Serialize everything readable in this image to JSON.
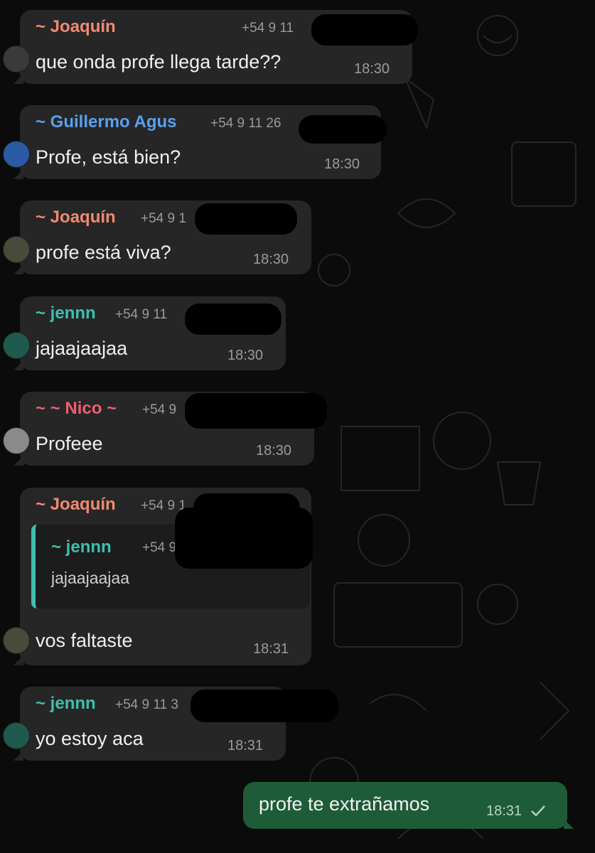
{
  "messages": [
    {
      "sender": "~ Joaquín",
      "sender_color": "#f08a72",
      "phone": "+54 9 11",
      "text": "que onda profe llega tarde??",
      "time": "18:30"
    },
    {
      "sender": "~ Guillermo Agus",
      "sender_color": "#5aa0ee",
      "phone": "+54 9 11 26",
      "text": "Profe, está bien?",
      "time": "18:30"
    },
    {
      "sender": "~ Joaquín",
      "sender_color": "#f08a72",
      "phone": "+54 9 1",
      "text": "profe está viva?",
      "time": "18:30"
    },
    {
      "sender": "~ jennn",
      "sender_color": "#3fbfae",
      "phone": "+54 9 11",
      "text": "jajaajaajaa",
      "time": "18:30"
    },
    {
      "sender": "~ ~ Nico ~",
      "sender_color": "#ee5f73",
      "phone": "+54 9",
      "text": "Profeee",
      "time": "18:30"
    },
    {
      "sender": "~ Joaquín",
      "sender_color": "#f08a72",
      "phone": "+54 9 1",
      "quote": {
        "sender": "~ jennn",
        "phone": "+54 9",
        "text": "jajaajaajaa"
      },
      "text": "vos faltaste",
      "time": "18:31"
    },
    {
      "sender": "~ jennn",
      "sender_color": "#3fbfae",
      "phone": "+54 9 11 3",
      "text": "yo estoy aca",
      "time": "18:31"
    }
  ],
  "outgoing": {
    "text": "profe te extrañamos",
    "time": "18:31",
    "status_icon": "checkmark-icon"
  }
}
